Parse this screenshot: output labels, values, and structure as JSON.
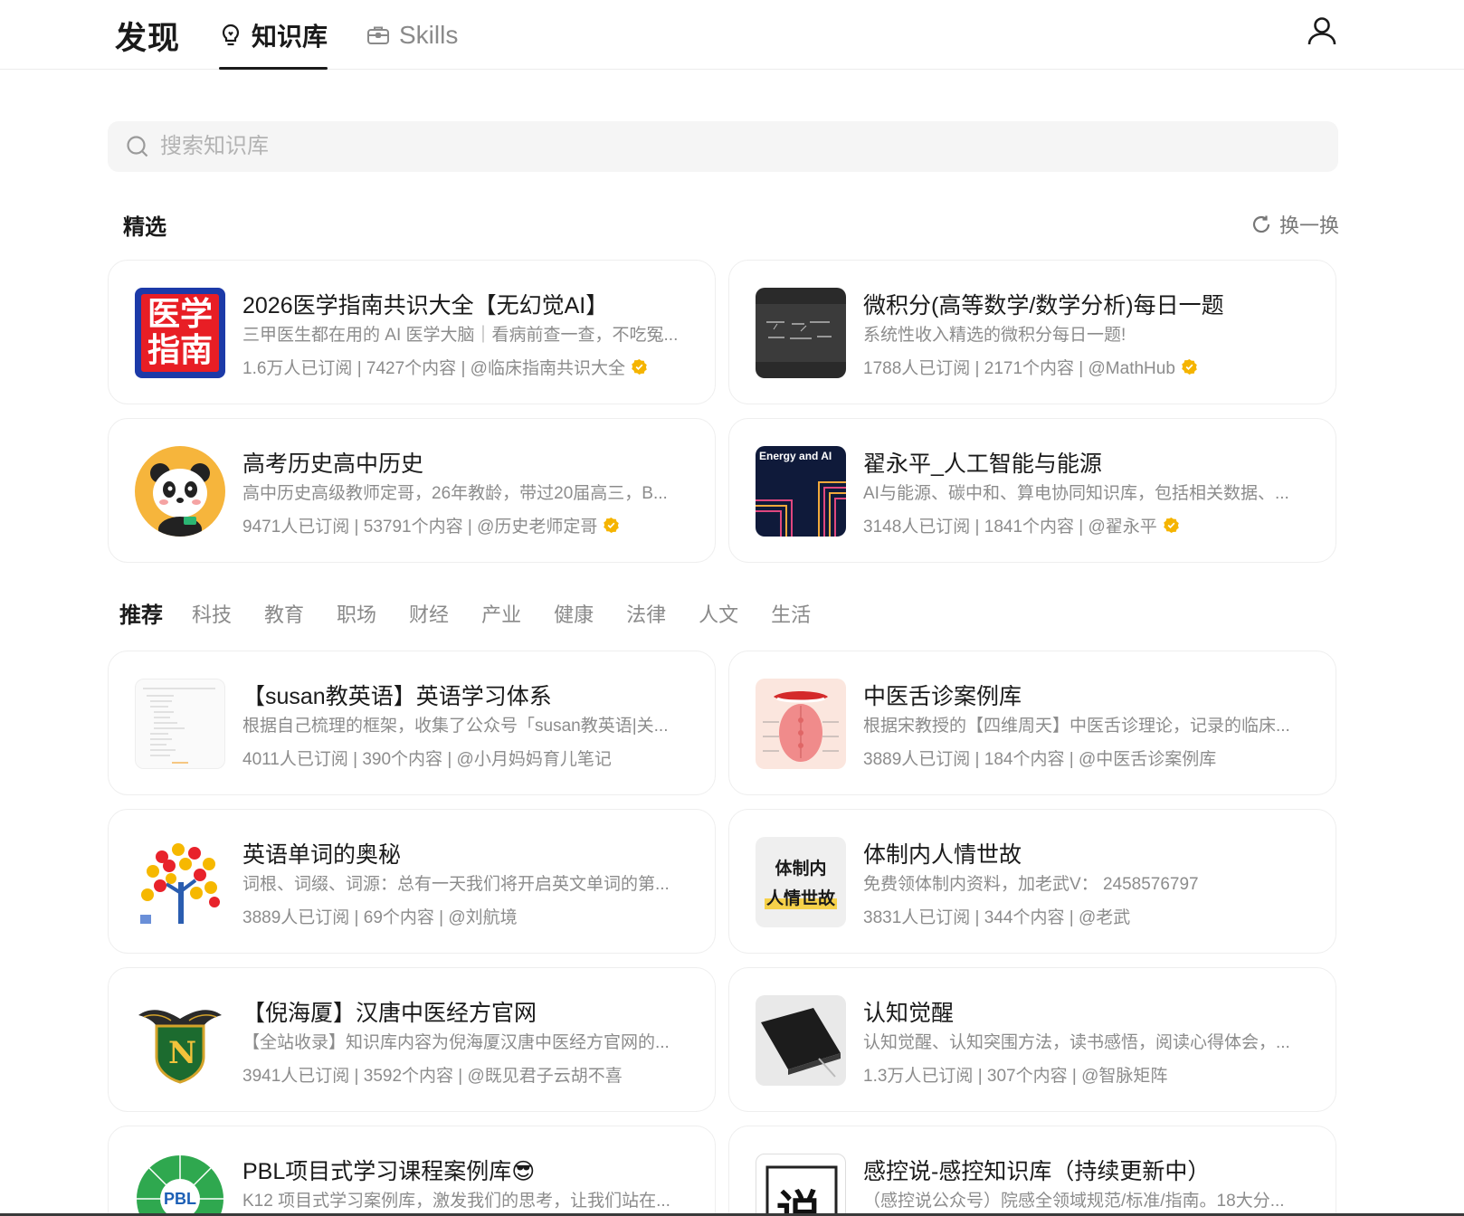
{
  "header": {
    "brand": "发现",
    "tab_kb": "知识库",
    "tab_skills": "Skills"
  },
  "search": {
    "placeholder": "搜索知识库"
  },
  "featured": {
    "title": "精选",
    "refresh": "换一换",
    "cards": [
      {
        "title": "2026医学指南共识大全【无幻觉AI】",
        "desc": "三甲医生都在用的 AI 医学大脑｜看病前查一查，不吃冤...",
        "meta": "1.6万人已订阅 | 7427个内容 | @临床指南共识大全",
        "thumb_text_1": "医学",
        "thumb_text_2": "指南"
      },
      {
        "title": "微积分(高等数学/数学分析)每日一题",
        "desc": "系统性收入精选的微积分每日一题!",
        "meta": "1788人已订阅 | 2171个内容 | @MathHub"
      },
      {
        "title": "高考历史高中历史",
        "desc": "高中历史高级教师定哥，26年教龄，带过20届高三，B...",
        "meta": "9471人已订阅 | 53791个内容 | @历史老师定哥"
      },
      {
        "title": "翟永平_人工智能与能源",
        "desc": "AI与能源、碳中和、算电协同知识库，包括相关数据、...",
        "meta": "3148人已订阅 | 1841个内容 | @翟永平",
        "thumb_text_1": "Energy and AI"
      }
    ]
  },
  "categories": [
    "推荐",
    "科技",
    "教育",
    "职场",
    "财经",
    "产业",
    "健康",
    "法律",
    "人文",
    "生活"
  ],
  "recommended": {
    "cards": [
      {
        "title": "【susan教英语】英语学习体系",
        "desc": "根据自己梳理的框架，收集了公众号「susan教英语|关...",
        "meta": "4011人已订阅 | 390个内容 | @小月妈妈育儿笔记"
      },
      {
        "title": "中医舌诊案例库",
        "desc": "根据宋教授的【四维周天】中医舌诊理论，记录的临床...",
        "meta": "3889人已订阅 | 184个内容 | @中医舌诊案例库"
      },
      {
        "title": "英语单词的奥秘",
        "desc": "词根、词缀、词源：总有一天我们将开启英文单词的第...",
        "meta": "3889人已订阅 | 69个内容 | @刘航境"
      },
      {
        "title": "体制内人情世故",
        "desc": "免费领体制内资料，加老武V：  2458576797",
        "meta": "3831人已订阅 | 344个内容 | @老武",
        "thumb_text_1": "体制内",
        "thumb_text_2": "人情世故"
      },
      {
        "title": "【倪海厦】汉唐中医经方官网",
        "desc": "【全站收录】知识库内容为倪海厦汉唐中医经方官网的...",
        "meta": "3941人已订阅 | 3592个内容 | @既见君子云胡不喜",
        "thumb_text_1": "N"
      },
      {
        "title": "认知觉醒",
        "desc": "认知觉醒、认知突围方法，读书感悟，阅读心得体会，...",
        "meta": "1.3万人已订阅 | 307个内容 | @智脉矩阵"
      },
      {
        "title": "PBL项目式学习课程案例库😎",
        "desc": "K12 项目式学习案例库，激发我们的思考，让我们站在...",
        "meta": "",
        "thumb_text_1": "PBL"
      },
      {
        "title": "感控说-感控知识库（持续更新中）",
        "desc": "（感控说公众号）院感全领域规范/标准/指南。18大分...",
        "meta": "",
        "thumb_text_1": "说"
      }
    ]
  },
  "colors": {
    "accent": "#1a1a1a",
    "muted": "#8c8c8c",
    "verified": "#f5b400"
  }
}
